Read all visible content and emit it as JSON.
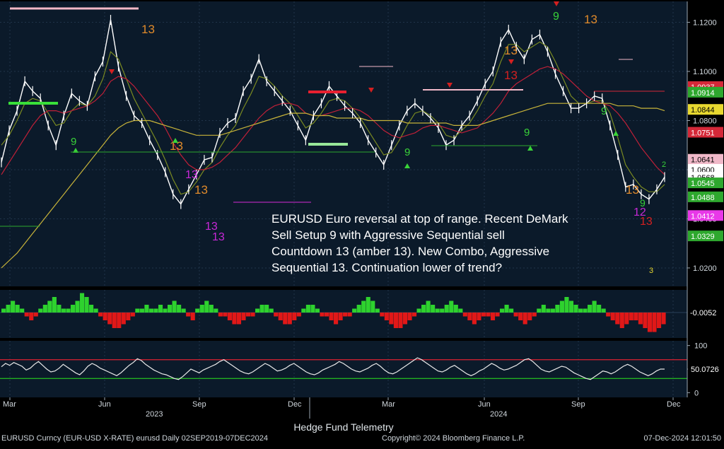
{
  "colors": {
    "panel_bg": "#0b1a2a",
    "grid": "#20344a",
    "price": "#ffffff",
    "ma_fast": "#7a8a22",
    "ma_mid": "#c02038",
    "ma_slow": "#c8b43a",
    "setup_green": "#39d339",
    "sell_red": "#d42020",
    "amber": "#e08a2a",
    "magenta": "#c828d8",
    "hist_pos": "#2ed22e",
    "hist_neg": "#e01818",
    "osc_line": "#e8e8e8"
  },
  "annotation": {
    "line1": "EURUSD Euro reversal at top of range.  Recent DeMark",
    "line2": "Sell Setup 9 with Aggressive Sequential sell",
    "line3": "Countdown 13 (amber 13). New Combo, Aggressive",
    "line4": "Sequential 13.  Continuation lower of trend?"
  },
  "footer": {
    "left": "EURUSD Curncy (EUR-USD X-RATE) eurusd  Daily 02SEP2019-07DEC2024",
    "center": "Copyright© 2024 Bloomberg Finance L.P.",
    "right": "07-Dec-2024 12:01:50",
    "source": "Hedge Fund Telemetry"
  },
  "x_axis": {
    "months": [
      "Mar",
      "Jun",
      "Sep",
      "Dec",
      "Mar",
      "Jun",
      "Sep",
      "Dec"
    ],
    "years": [
      "2023",
      "2024"
    ]
  },
  "chart_data": [
    {
      "type": "line",
      "panel": "price",
      "ticks": [
        "1.1200",
        "1.1000",
        "1.0800",
        "1.0600",
        "1.0400",
        "1.0200"
      ],
      "ylim": [
        1.0125,
        1.1285
      ],
      "price_labels": [
        {
          "text": "1.0937",
          "value": 1.0937,
          "color": "#d42838"
        },
        {
          "text": "1.0914",
          "value": 1.0914,
          "color": "#2ea82e"
        },
        {
          "text": "1.0844",
          "value": 1.0844,
          "color": "#e8d830"
        },
        {
          "text": "1.0751",
          "value": 1.0751,
          "color": "#d42838"
        },
        {
          "text": "1.0641",
          "value": 1.0641,
          "color": "#f0b8c8"
        },
        {
          "text": "1.0600",
          "value": 1.06,
          "color": "#ffffff"
        },
        {
          "text": "1.0568",
          "value": 1.0568,
          "color": "#ffffff"
        },
        {
          "text": "1.0545",
          "value": 1.0545,
          "color": "#2ea82e"
        },
        {
          "text": "1.0488",
          "value": 1.0488,
          "color": "#2ea82e"
        },
        {
          "text": "1.0412",
          "value": 1.0412,
          "color": "#e838e8"
        },
        {
          "text": "1.0329",
          "value": 1.0329,
          "color": "#2ea82e"
        }
      ],
      "series": [
        {
          "values": [
            1.063,
            1.076,
            1.084,
            1.096,
            1.092,
            1.089,
            1.078,
            1.07,
            1.082,
            1.091,
            1.088,
            1.086,
            1.098,
            1.104,
            1.121,
            1.102,
            1.09,
            1.082,
            1.079,
            1.072,
            1.066,
            1.059,
            1.05,
            1.046,
            1.052,
            1.058,
            1.064,
            1.065,
            1.075,
            1.079,
            1.081,
            1.092,
            1.097,
            1.105,
            1.096,
            1.092,
            1.088,
            1.084,
            1.078,
            1.072,
            1.082,
            1.087,
            1.094,
            1.09,
            1.086,
            1.083,
            1.079,
            1.072,
            1.067,
            1.062,
            1.07,
            1.078,
            1.084,
            1.087,
            1.084,
            1.081,
            1.077,
            1.07,
            1.072,
            1.078,
            1.082,
            1.088,
            1.095,
            1.1,
            1.112,
            1.117,
            1.11,
            1.105,
            1.113,
            1.115,
            1.108,
            1.099,
            1.092,
            1.085,
            1.085,
            1.087,
            1.09,
            1.089,
            1.078,
            1.066,
            1.053,
            1.054,
            1.05,
            1.048,
            1.052,
            1.057
          ]
        },
        {
          "values": [
            1.07,
            1.074,
            1.08,
            1.087,
            1.089,
            1.088,
            1.083,
            1.078,
            1.079,
            1.084,
            1.087,
            1.086,
            1.09,
            1.097,
            1.108,
            1.105,
            1.097,
            1.089,
            1.083,
            1.077,
            1.071,
            1.064,
            1.056,
            1.05,
            1.051,
            1.055,
            1.06,
            1.063,
            1.069,
            1.074,
            1.078,
            1.085,
            1.091,
            1.098,
            1.097,
            1.094,
            1.09,
            1.087,
            1.082,
            1.077,
            1.079,
            1.083,
            1.088,
            1.089,
            1.088,
            1.085,
            1.081,
            1.076,
            1.071,
            1.066,
            1.067,
            1.072,
            1.078,
            1.083,
            1.084,
            1.082,
            1.079,
            1.074,
            1.073,
            1.076,
            1.079,
            1.084,
            1.09,
            1.095,
            1.104,
            1.111,
            1.111,
            1.108,
            1.11,
            1.112,
            1.11,
            1.104,
            1.097,
            1.09,
            1.087,
            1.087,
            1.088,
            1.088,
            1.083,
            1.073,
            1.062,
            1.057,
            1.053,
            1.051,
            1.051,
            1.054
          ]
        },
        {
          "values": [
            1.058,
            1.063,
            1.068,
            1.073,
            1.078,
            1.082,
            1.084,
            1.084,
            1.083,
            1.084,
            1.085,
            1.086,
            1.088,
            1.091,
            1.096,
            1.098,
            1.097,
            1.094,
            1.09,
            1.086,
            1.082,
            1.077,
            1.071,
            1.066,
            1.062,
            1.06,
            1.06,
            1.061,
            1.063,
            1.066,
            1.069,
            1.073,
            1.077,
            1.081,
            1.084,
            1.086,
            1.087,
            1.087,
            1.086,
            1.083,
            1.082,
            1.082,
            1.083,
            1.084,
            1.085,
            1.085,
            1.084,
            1.082,
            1.079,
            1.076,
            1.074,
            1.073,
            1.074,
            1.075,
            1.077,
            1.078,
            1.078,
            1.077,
            1.076,
            1.075,
            1.076,
            1.077,
            1.08,
            1.083,
            1.087,
            1.092,
            1.095,
            1.097,
            1.099,
            1.101,
            1.102,
            1.101,
            1.099,
            1.096,
            1.093,
            1.09,
            1.088,
            1.087,
            1.086,
            1.083,
            1.079,
            1.074,
            1.069,
            1.065,
            1.061,
            1.058
          ]
        },
        {
          "values": [
            1.02,
            1.023,
            1.026,
            1.03,
            1.034,
            1.038,
            1.042,
            1.046,
            1.05,
            1.054,
            1.058,
            1.062,
            1.066,
            1.07,
            1.074,
            1.077,
            1.079,
            1.08,
            1.08,
            1.08,
            1.079,
            1.078,
            1.077,
            1.076,
            1.075,
            1.074,
            1.074,
            1.074,
            1.074,
            1.075,
            1.076,
            1.077,
            1.078,
            1.079,
            1.08,
            1.081,
            1.082,
            1.083,
            1.083,
            1.083,
            1.082,
            1.082,
            1.082,
            1.081,
            1.081,
            1.081,
            1.081,
            1.08,
            1.08,
            1.08,
            1.08,
            1.08,
            1.079,
            1.079,
            1.079,
            1.079,
            1.079,
            1.079,
            1.078,
            1.078,
            1.078,
            1.078,
            1.079,
            1.08,
            1.081,
            1.082,
            1.083,
            1.084,
            1.085,
            1.086,
            1.087,
            1.087,
            1.087,
            1.087,
            1.087,
            1.087,
            1.087,
            1.087,
            1.087,
            1.086,
            1.086,
            1.086,
            1.085,
            1.085,
            1.085,
            1.084
          ]
        }
      ]
    },
    {
      "type": "bar",
      "panel": "histogram",
      "value_label": "-0.0052",
      "values": [
        1,
        2,
        3,
        2,
        1,
        -1,
        -2,
        -1,
        1,
        2,
        3,
        4,
        2,
        1,
        1,
        2,
        3,
        5,
        4,
        2,
        1,
        -1,
        -2,
        -3,
        -4,
        -4,
        -3,
        -2,
        -1,
        1,
        1,
        2,
        1,
        1,
        2,
        1,
        2,
        3,
        2,
        1,
        -1,
        -2,
        1,
        2,
        3,
        2,
        1,
        -1,
        -1,
        -2,
        -3,
        -3,
        -2,
        -1,
        -1,
        1,
        2,
        2,
        1,
        -1,
        -2,
        -3,
        -3,
        -2,
        -1,
        1,
        2,
        2,
        1,
        -1,
        -1,
        -2,
        -3,
        -2,
        -1,
        -1,
        1,
        2,
        3,
        4,
        3,
        1,
        -1,
        -2,
        -3,
        -4,
        -4,
        -3,
        -2,
        -1,
        1,
        2,
        3,
        2,
        1,
        1,
        2,
        3,
        2,
        1,
        -1,
        -2,
        -3,
        -2,
        -1,
        -1,
        -2,
        -1,
        1,
        2,
        1,
        -1,
        -2,
        -3,
        -2,
        -1,
        1,
        2,
        1,
        1,
        2,
        3,
        4,
        3,
        2,
        1,
        1,
        2,
        3,
        2,
        1,
        -1,
        -2,
        -3,
        -4,
        -3,
        -2,
        -2,
        -3,
        -4,
        -5,
        -5,
        -4,
        -3
      ]
    },
    {
      "type": "line",
      "panel": "oscillator",
      "ticks": [
        "100",
        "50",
        "0"
      ],
      "value_label": "50.0726",
      "ylim": [
        -10,
        110
      ],
      "levels": [
        70,
        30
      ],
      "values": [
        55,
        62,
        58,
        64,
        60,
        56,
        48,
        52,
        60,
        66,
        58,
        50,
        44,
        46,
        52,
        60,
        54,
        48,
        42,
        38,
        46,
        56,
        62,
        58,
        52,
        48,
        44,
        40,
        36,
        42,
        50,
        58,
        64,
        72,
        68,
        60,
        54,
        48,
        44,
        40,
        38,
        34,
        30,
        28,
        34,
        42,
        50,
        46,
        42,
        48,
        52,
        56,
        60,
        66,
        70,
        64,
        58,
        52,
        46,
        42,
        40,
        44,
        50,
        56,
        62,
        58,
        52,
        46,
        48,
        52,
        58,
        62,
        56,
        50,
        44,
        40,
        38,
        42,
        48,
        52,
        56,
        60,
        66,
        62,
        56,
        50,
        46,
        44,
        48,
        52,
        58,
        62,
        56,
        48,
        42,
        40,
        44,
        50,
        56,
        62,
        68,
        74,
        70,
        64,
        58,
        52,
        46,
        44,
        48,
        54,
        58,
        52,
        46,
        40,
        36,
        40,
        46,
        50,
        56,
        62,
        58,
        52,
        48,
        50,
        54,
        58,
        64,
        70,
        72,
        66,
        58,
        50,
        46,
        44,
        48,
        52,
        56,
        54,
        48,
        42,
        38,
        34,
        30,
        28,
        34,
        40,
        46,
        44,
        40,
        44,
        50,
        56,
        60,
        56,
        50,
        44,
        40,
        36,
        40,
        46,
        50,
        50
      ]
    }
  ]
}
